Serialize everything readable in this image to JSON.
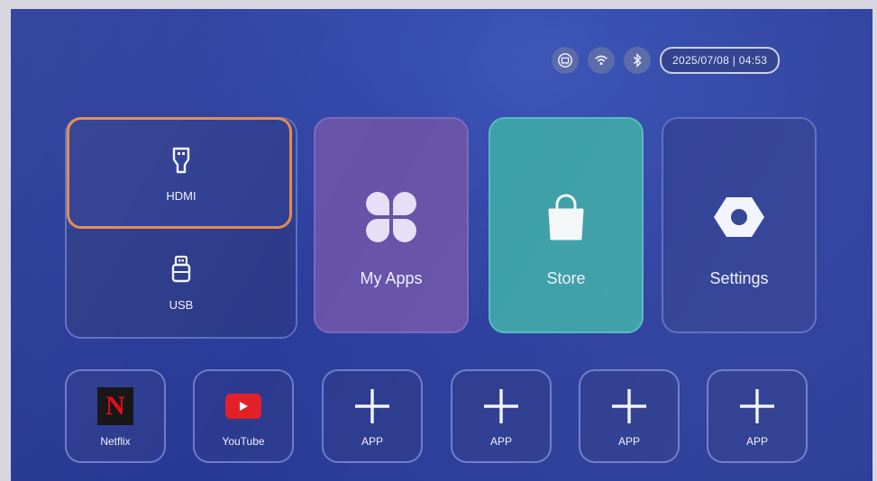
{
  "status": {
    "icons": [
      "ethernet-icon",
      "wifi-icon",
      "bluetooth-icon"
    ],
    "datetime": "2025/07/08 | 04:53"
  },
  "sources": {
    "hdmi": {
      "label": "HDMI",
      "icon": "hdmi-icon",
      "focused": true
    },
    "usb": {
      "label": "USB",
      "icon": "usb-icon"
    }
  },
  "main_tiles": [
    {
      "label": "My Apps",
      "icon": "apps-grid-icon",
      "color": "#6753a8"
    },
    {
      "label": "Store",
      "icon": "shopping-bag-icon",
      "color": "#3c9fa7"
    },
    {
      "label": "Settings",
      "icon": "settings-hex-icon",
      "color": "#2f3f95"
    }
  ],
  "app_tiles": [
    {
      "label": "Netflix",
      "icon": "netflix-icon"
    },
    {
      "label": "YouTube",
      "icon": "youtube-icon"
    },
    {
      "label": "APP",
      "icon": "plus-icon"
    },
    {
      "label": "APP",
      "icon": "plus-icon"
    },
    {
      "label": "APP",
      "icon": "plus-icon"
    },
    {
      "label": "APP",
      "icon": "plus-icon"
    }
  ],
  "colors": {
    "focus": "#e38a4d",
    "background": "#2c3f9e"
  },
  "netflix_mark": "N"
}
